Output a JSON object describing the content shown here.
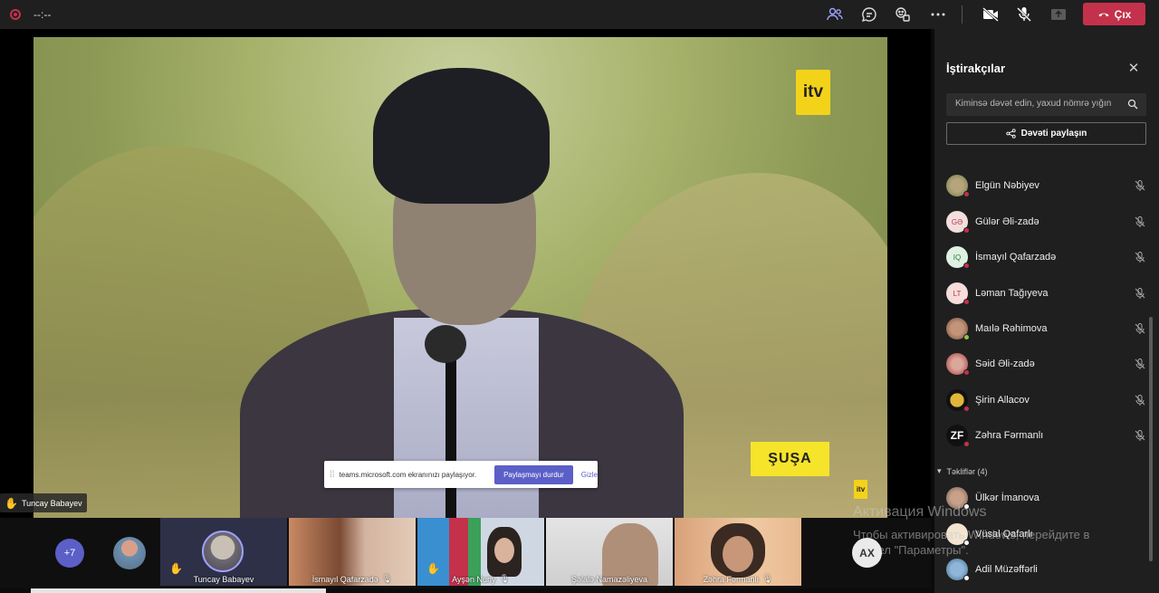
{
  "topbar": {
    "timer": "--:--",
    "leave_label": "Çıx",
    "icons": [
      "participants-icon",
      "chat-icon",
      "reactions-icon",
      "more-icon",
      "camera-off-icon",
      "mic-off-icon",
      "share-icon",
      "phone-hangup-icon"
    ],
    "leave_color": "#c4314b"
  },
  "stage": {
    "itv_logo": "itv",
    "itv_small": "itv",
    "city_caption": "ŞUŞA",
    "presenter_name": "Tuncay Babayev"
  },
  "share_bar": {
    "message": "teams.microsoft.com ekranınızı paylaşıyor.",
    "stop_label": "Paylaşmayı durdur",
    "hide_label": "Gizle"
  },
  "strip": {
    "more_count": "+7",
    "tiles": [
      {
        "name": "Tuncay Babayev"
      },
      {
        "name": "İsmayıl Qafarzadə"
      },
      {
        "name": "Ayşən Nuriy"
      },
      {
        "name": "Şəlalə Namazəliyeva"
      },
      {
        "name": "Zəhra Fərmanlı"
      }
    ]
  },
  "sidebar": {
    "title": "İştirakçılar",
    "search_placeholder": "Kiminsə dəvət edin, yaxud nömrə yığın",
    "invite_label": "Dəvəti paylaşın",
    "participants": [
      {
        "name": "Elgün Nəbiyev",
        "initials": "",
        "status": "#c4314b"
      },
      {
        "name": "Gülər Əli-zadə",
        "initials": "GƏ",
        "status": "#c4314b"
      },
      {
        "name": "İsmayıl Qafarzadə",
        "initials": "IQ",
        "status": "#c4314b"
      },
      {
        "name": "Ləman Tağıyeva",
        "initials": "LT",
        "status": "#c4314b"
      },
      {
        "name": "Maılə Rəhimova",
        "initials": "",
        "status": "#92c353"
      },
      {
        "name": "Səid Əli-zadə",
        "initials": "",
        "status": "#c4314b"
      },
      {
        "name": "Şirin Allacov",
        "initials": "",
        "status": "#c4314b"
      },
      {
        "name": "Zəhra Fərmanlı",
        "initials": "ZF",
        "status": "#c4314b"
      }
    ],
    "section_label": "Təkliflər (4)",
    "suggestions": [
      {
        "name": "Ülkər İmanova",
        "status": "#ffffff"
      },
      {
        "name": "Vüsal Qafarlı",
        "status": "#ffffff"
      },
      {
        "name": "Adil Müzəffərli",
        "status": "#ffffff"
      }
    ]
  },
  "overlay": {
    "activation_title": "Активация Windows",
    "activation_line1": "Чтобы активировать Windows, перейдите в",
    "activation_line2": "раздел \"Параметры\".",
    "ax_badge": "AX"
  }
}
